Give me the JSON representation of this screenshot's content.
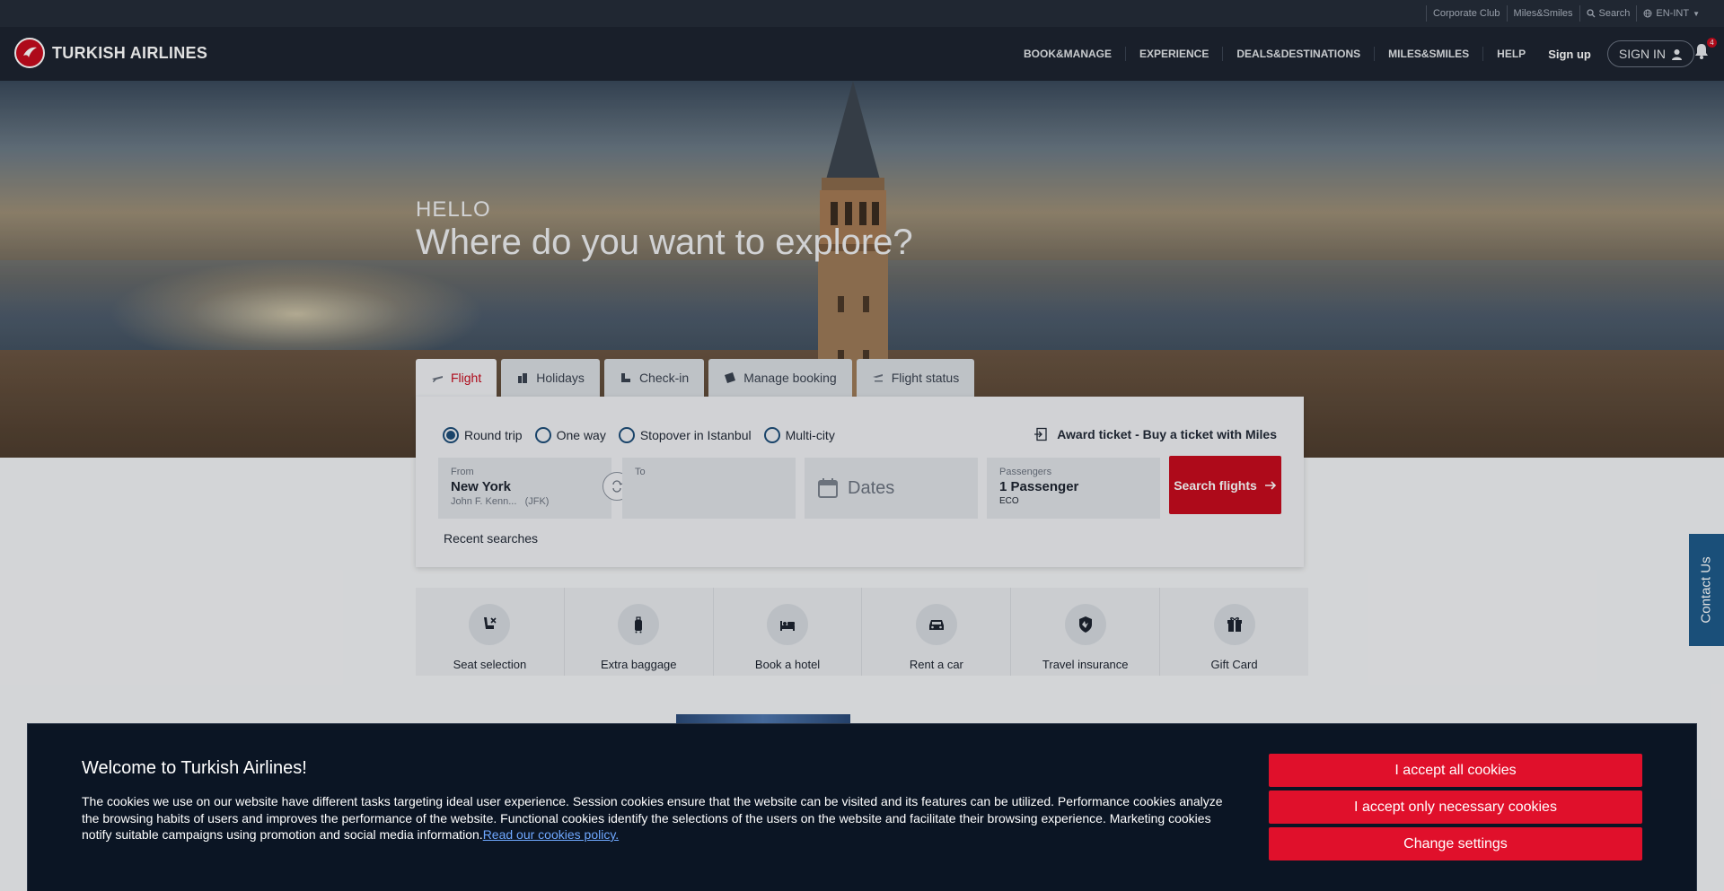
{
  "topbar": {
    "corporate_club": "Corporate Club",
    "miles_smiles": "Miles&Smiles",
    "search": "Search",
    "language": "EN-INT"
  },
  "nav": {
    "brand": "TURKISH AIRLINES",
    "links": [
      "BOOK&MANAGE",
      "EXPERIENCE",
      "DEALS&DESTINATIONS",
      "MILES&SMILES",
      "HELP"
    ],
    "signup": "Sign up",
    "signin": "SIGN IN",
    "notification_count": "4"
  },
  "hero": {
    "hello": "HELLO",
    "title": "Where do you want to explore?"
  },
  "booking": {
    "tabs": [
      "Flight",
      "Holidays",
      "Check-in",
      "Manage booking",
      "Flight status"
    ],
    "active_tab": "Flight",
    "trip_types": [
      "Round trip",
      "One way",
      "Stopover in Istanbul",
      "Multi-city"
    ],
    "selected_trip": "Round trip",
    "award_ticket": "Award ticket - Buy a ticket with Miles",
    "from": {
      "label": "From",
      "city": "New York",
      "airport": "John F. Kenn...",
      "code": "(JFK)"
    },
    "to": {
      "label": "To",
      "city": ""
    },
    "dates": {
      "placeholder": "Dates"
    },
    "passengers": {
      "label": "Passengers",
      "value": "1 Passenger",
      "cabin": "ECO"
    },
    "search_button": "Search flights",
    "recent_searches": "Recent searches"
  },
  "services": [
    {
      "label": "Seat selection",
      "icon": "seat-icon"
    },
    {
      "label": "Extra baggage",
      "icon": "baggage-icon"
    },
    {
      "label": "Book a hotel",
      "icon": "bed-icon"
    },
    {
      "label": "Rent a car",
      "icon": "car-icon"
    },
    {
      "label": "Travel insurance",
      "icon": "shield-icon"
    },
    {
      "label": "Gift Card",
      "icon": "gift-icon"
    }
  ],
  "contact": "Contact Us",
  "cookie": {
    "title": "Welcome to Turkish Airlines!",
    "body": "The cookies we use on our website have different tasks targeting ideal user experience. Session cookies ensure that the website can be visited and its features can be utilized. Performance cookies analyze the browsing habits of users and improves the performance of the website. Functional cookies identify the selections of the users on the website and facilitate their browsing experience. Marketing cookies notify suitable campaigns using promotion and social media information.",
    "link": "Read our cookies policy.",
    "accept_all": "I accept all cookies",
    "accept_necessary": "I accept only necessary cookies",
    "change_settings": "Change settings"
  },
  "colors": {
    "brand_red": "#c60c1e",
    "nav_bg": "#1d2430",
    "accent_blue": "#1e4e79"
  }
}
